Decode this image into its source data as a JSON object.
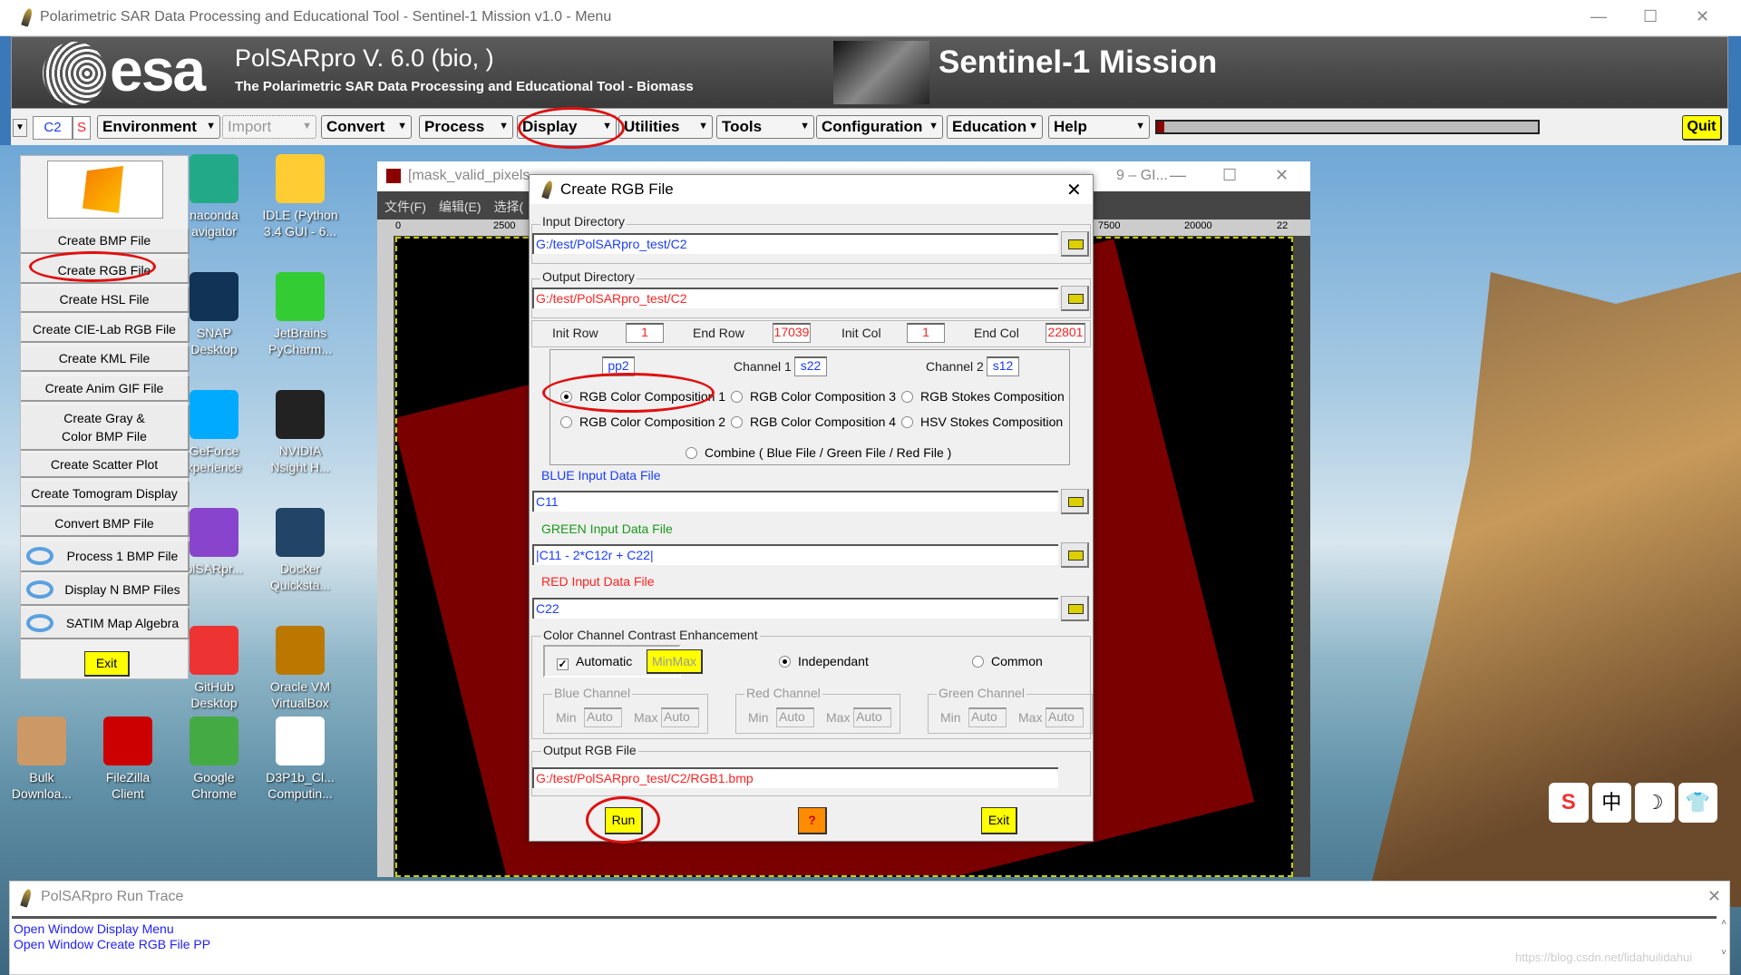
{
  "window": {
    "title": "Polarimetric SAR Data Processing and Educational Tool - Sentinel-1 Mission v1.0 - Menu"
  },
  "banner": {
    "logo": "esa",
    "product": "PolSARpro V. 6.0 (bio, )",
    "subtitle": "The Polarimetric SAR Data Processing and Educational Tool - Biomass",
    "mission": "Sentinel-1 Mission"
  },
  "toolbar": {
    "mode": "C2",
    "mode_flag": "S",
    "menus": [
      "Environment",
      "Import",
      "Convert",
      "Process",
      "Display",
      "Utilities",
      "Tools",
      "Configuration",
      "Education",
      "Help"
    ],
    "progress": 0.02,
    "quit": "Quit"
  },
  "display_menu": {
    "items": [
      "Create BMP File",
      "Create RGB File",
      "Create HSL File",
      "Create CIE-Lab RGB File",
      "Create KML File",
      "Create Anim GIF File",
      "Create Gray &\nColor BMP File",
      "Create Scatter Plot",
      "Create Tomogram Display",
      "Convert BMP File"
    ],
    "icon_items": [
      "Process 1 BMP File",
      "Display N BMP Files",
      "SATIM Map Algebra"
    ],
    "exit": "Exit"
  },
  "gimp": {
    "title": "[mask_valid_pixels",
    "title_tail": "9 – GI...",
    "menus": [
      "文件(F)",
      "编辑(E)",
      "选择("
    ],
    "ruler": [
      "0",
      "2500",
      "7500",
      "20000",
      "22"
    ]
  },
  "dialog": {
    "title": "Create RGB File",
    "input_dir_label": "Input Directory",
    "input_dir": "G:/test/PolSARpro_test/C2",
    "output_dir_label": "Output Directory",
    "output_dir": "G:/test/PolSARpro_test/C2",
    "init_row_label": "Init Row",
    "init_row": "1",
    "end_row_label": "End Row",
    "end_row": "17039",
    "init_col_label": "Init Col",
    "init_col": "1",
    "end_col_label": "End Col",
    "end_col": "22801",
    "pol": "pp2",
    "channel1_label": "Channel 1",
    "channel1": "s22",
    "channel2_label": "Channel 2",
    "channel2": "s12",
    "compositions": [
      "RGB Color Composition 1",
      "RGB Color Composition 3",
      "RGB Stokes Composition",
      "RGB Color Composition 2",
      "RGB Color Composition 4",
      "HSV Stokes Composition"
    ],
    "combine": "Combine ( Blue File / Green File / Red File )",
    "selected_composition": "RGB Color Composition 1",
    "blue_label": "BLUE Input Data File",
    "blue": "C11",
    "green_label": "GREEN Input Data File",
    "green": "|C11 - 2*C12r + C22|",
    "red_label": "RED Input Data File",
    "red": "C22",
    "contrast_label": "Color Channel Contrast Enhancement",
    "automatic": "Automatic",
    "automatic_checked": true,
    "minmax": "MinMax",
    "independant": "Independant",
    "common": "Common",
    "contrast_mode": "Independant",
    "channels": [
      {
        "name": "Blue Channel",
        "min": "Auto",
        "max": "Auto"
      },
      {
        "name": "Red Channel",
        "min": "Auto",
        "max": "Auto"
      },
      {
        "name": "Green Channel",
        "min": "Auto",
        "max": "Auto"
      }
    ],
    "min_label": "Min",
    "max_label": "Max",
    "output_label": "Output RGB File",
    "output": "G:/test/PolSARpro_test/C2/RGB1.bmp",
    "run": "Run",
    "help": "?",
    "exit": "Exit",
    "colors": {
      "blue_label": "#1a3cff",
      "green_label": "#1a9a1a",
      "red_label": "#ff2020",
      "highlight": "#ffff00"
    }
  },
  "desktop": {
    "icons": [
      {
        "label": "naconda\navigator",
        "col": 0,
        "row": 0
      },
      {
        "label": "IDLE (Python\n3.4 GUI - 6...",
        "col": 1,
        "row": 0
      },
      {
        "label": "SNAP\nDesktop",
        "col": 0,
        "row": 1
      },
      {
        "label": "JetBrains\nPyCharm...",
        "col": 1,
        "row": 1
      },
      {
        "label": "GeForce\nxperience",
        "col": 0,
        "row": 2
      },
      {
        "label": "NVIDIA\nNsight H...",
        "col": 1,
        "row": 2
      },
      {
        "label": "olSARpr...",
        "col": 0,
        "row": 3
      },
      {
        "label": "Docker\nQuicksta...",
        "col": 1,
        "row": 3
      },
      {
        "label": "GitHub\nDesktop",
        "col": 0,
        "row": 4
      },
      {
        "label": "Oracle VM\nVirtualBox",
        "col": 1,
        "row": 4
      }
    ],
    "bottom_icons": [
      "Bulk\nDownloa...",
      "FileZilla\nClient",
      "Google\nChrome",
      "D3P1b_Cl...\nComputin..."
    ]
  },
  "trace": {
    "title": "PolSARpro Run Trace",
    "lines": [
      "Open Window Display Menu",
      "Open Window Create RGB File PP"
    ],
    "watermark": "https://blog.csdn.net/lidahuilidahui"
  }
}
